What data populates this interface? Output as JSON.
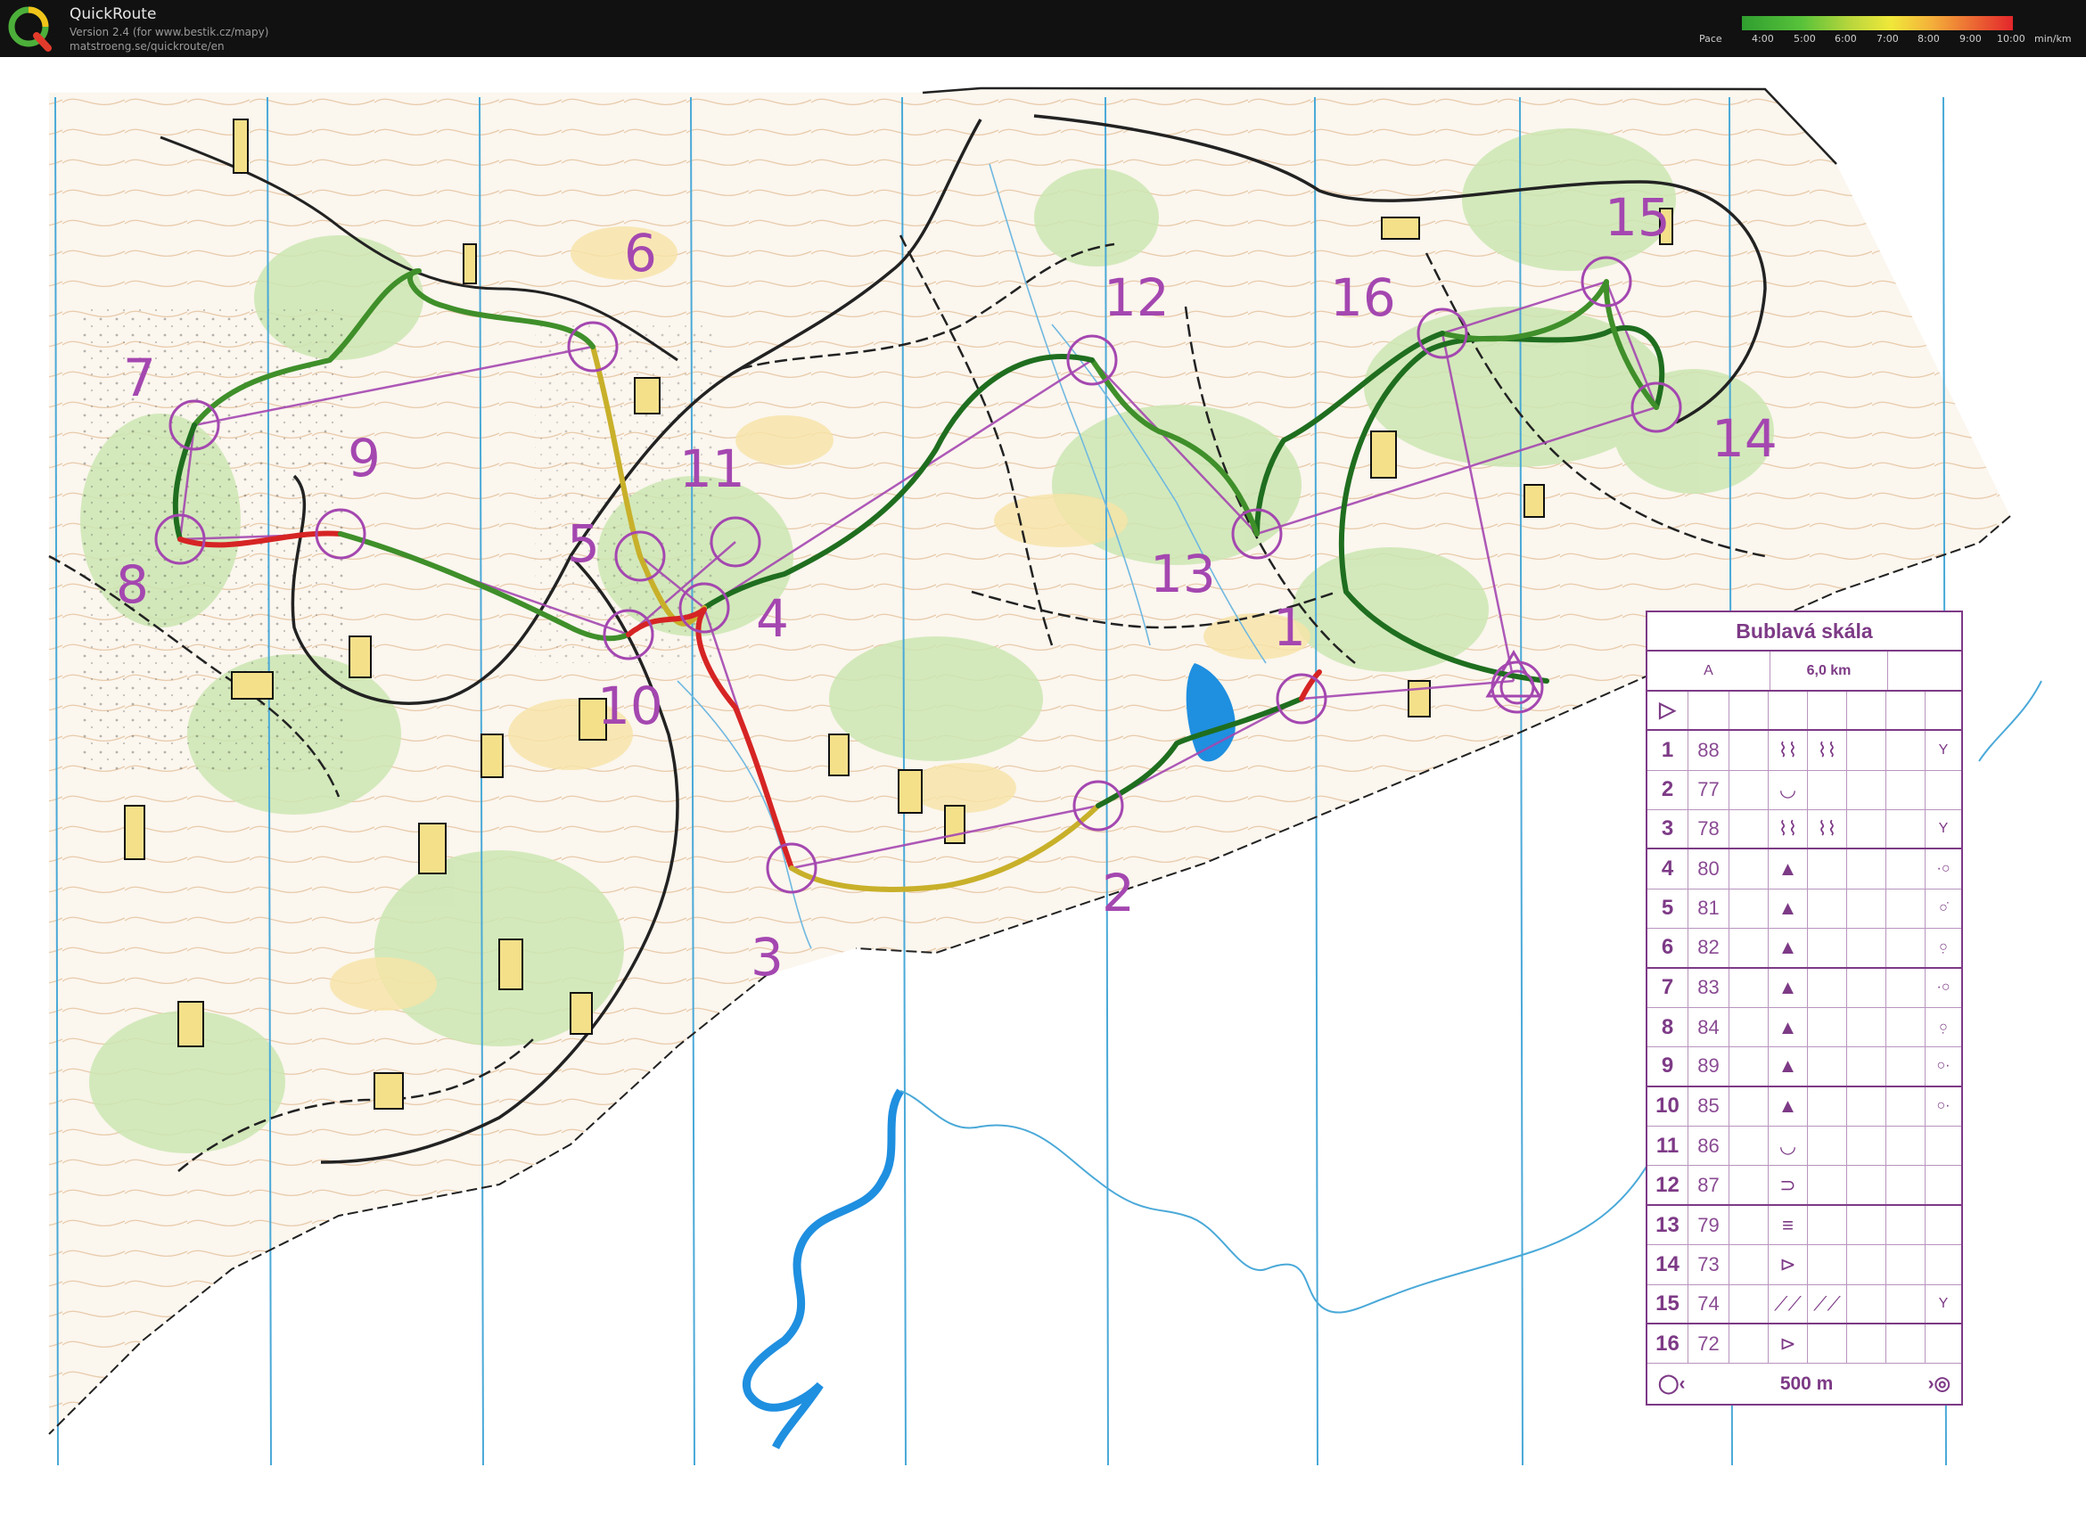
{
  "app": {
    "name": "QuickRoute",
    "version_line": "Version 2.4  (for www.bestik.cz/mapy)",
    "site_line": "matstroeng.se/quickroute/en"
  },
  "pace_legend": {
    "label": "Pace",
    "ticks": [
      "4:00",
      "5:00",
      "6:00",
      "7:00",
      "8:00",
      "9:00",
      "10:00"
    ],
    "unit": "min/km",
    "colors": [
      "#2f9e2f",
      "#58c23a",
      "#b9d63c",
      "#f0e83a",
      "#f4b03a",
      "#ec6a33",
      "#e3262b"
    ]
  },
  "map": {
    "course_color": "#a447b0",
    "route_colors": {
      "fast": "#1f6e1f",
      "medium": "#c8b02a",
      "slow": "#d62424"
    },
    "controls": [
      {
        "label": "1"
      },
      {
        "label": "2"
      },
      {
        "label": "3"
      },
      {
        "label": "4"
      },
      {
        "label": "5"
      },
      {
        "label": "6"
      },
      {
        "label": "7"
      },
      {
        "label": "8"
      },
      {
        "label": "9"
      },
      {
        "label": "10"
      },
      {
        "label": "11"
      },
      {
        "label": "12"
      },
      {
        "label": "13"
      },
      {
        "label": "14"
      },
      {
        "label": "15"
      },
      {
        "label": "16"
      }
    ]
  },
  "description_sheet": {
    "event": "Bublavá skála",
    "category": "A",
    "length": "6,0 km",
    "start_symbol": "▷",
    "rows": [
      {
        "num": "1",
        "code": "88",
        "feature": "rock-pits",
        "appearance": "rock-pits",
        "extra": "junction"
      },
      {
        "num": "2",
        "code": "77",
        "feature": "re-entrant",
        "appearance": "",
        "extra": ""
      },
      {
        "num": "3",
        "code": "78",
        "feature": "rock-pits",
        "appearance": "rock-pits",
        "extra": "junction"
      },
      {
        "num": "4",
        "code": "80",
        "feature": "boulder",
        "appearance": "",
        "extra": "side-circle"
      },
      {
        "num": "5",
        "code": "81",
        "feature": "boulder",
        "appearance": "",
        "extra": "top-circle"
      },
      {
        "num": "6",
        "code": "82",
        "feature": "boulder",
        "appearance": "",
        "extra": "foot-circle"
      },
      {
        "num": "7",
        "code": "83",
        "feature": "boulder",
        "appearance": "",
        "extra": "side-circle"
      },
      {
        "num": "8",
        "code": "84",
        "feature": "boulder",
        "appearance": "",
        "extra": "foot-circle"
      },
      {
        "num": "9",
        "code": "89",
        "feature": "boulder",
        "appearance": "",
        "extra": "right-circle"
      },
      {
        "num": "10",
        "code": "85",
        "feature": "boulder",
        "appearance": "",
        "extra": "right-circle"
      },
      {
        "num": "11",
        "code": "86",
        "feature": "re-entrant",
        "appearance": "",
        "extra": ""
      },
      {
        "num": "12",
        "code": "87",
        "feature": "spur",
        "appearance": "",
        "extra": ""
      },
      {
        "num": "13",
        "code": "79",
        "feature": "marsh",
        "appearance": "",
        "extra": ""
      },
      {
        "num": "14",
        "code": "73",
        "feature": "ruin",
        "appearance": "",
        "extra": ""
      },
      {
        "num": "15",
        "code": "74",
        "feature": "ditch",
        "appearance": "ditch",
        "extra": "junction"
      },
      {
        "num": "16",
        "code": "72",
        "feature": "ruin",
        "appearance": "",
        "extra": ""
      }
    ],
    "finish_distance": "500 m"
  }
}
